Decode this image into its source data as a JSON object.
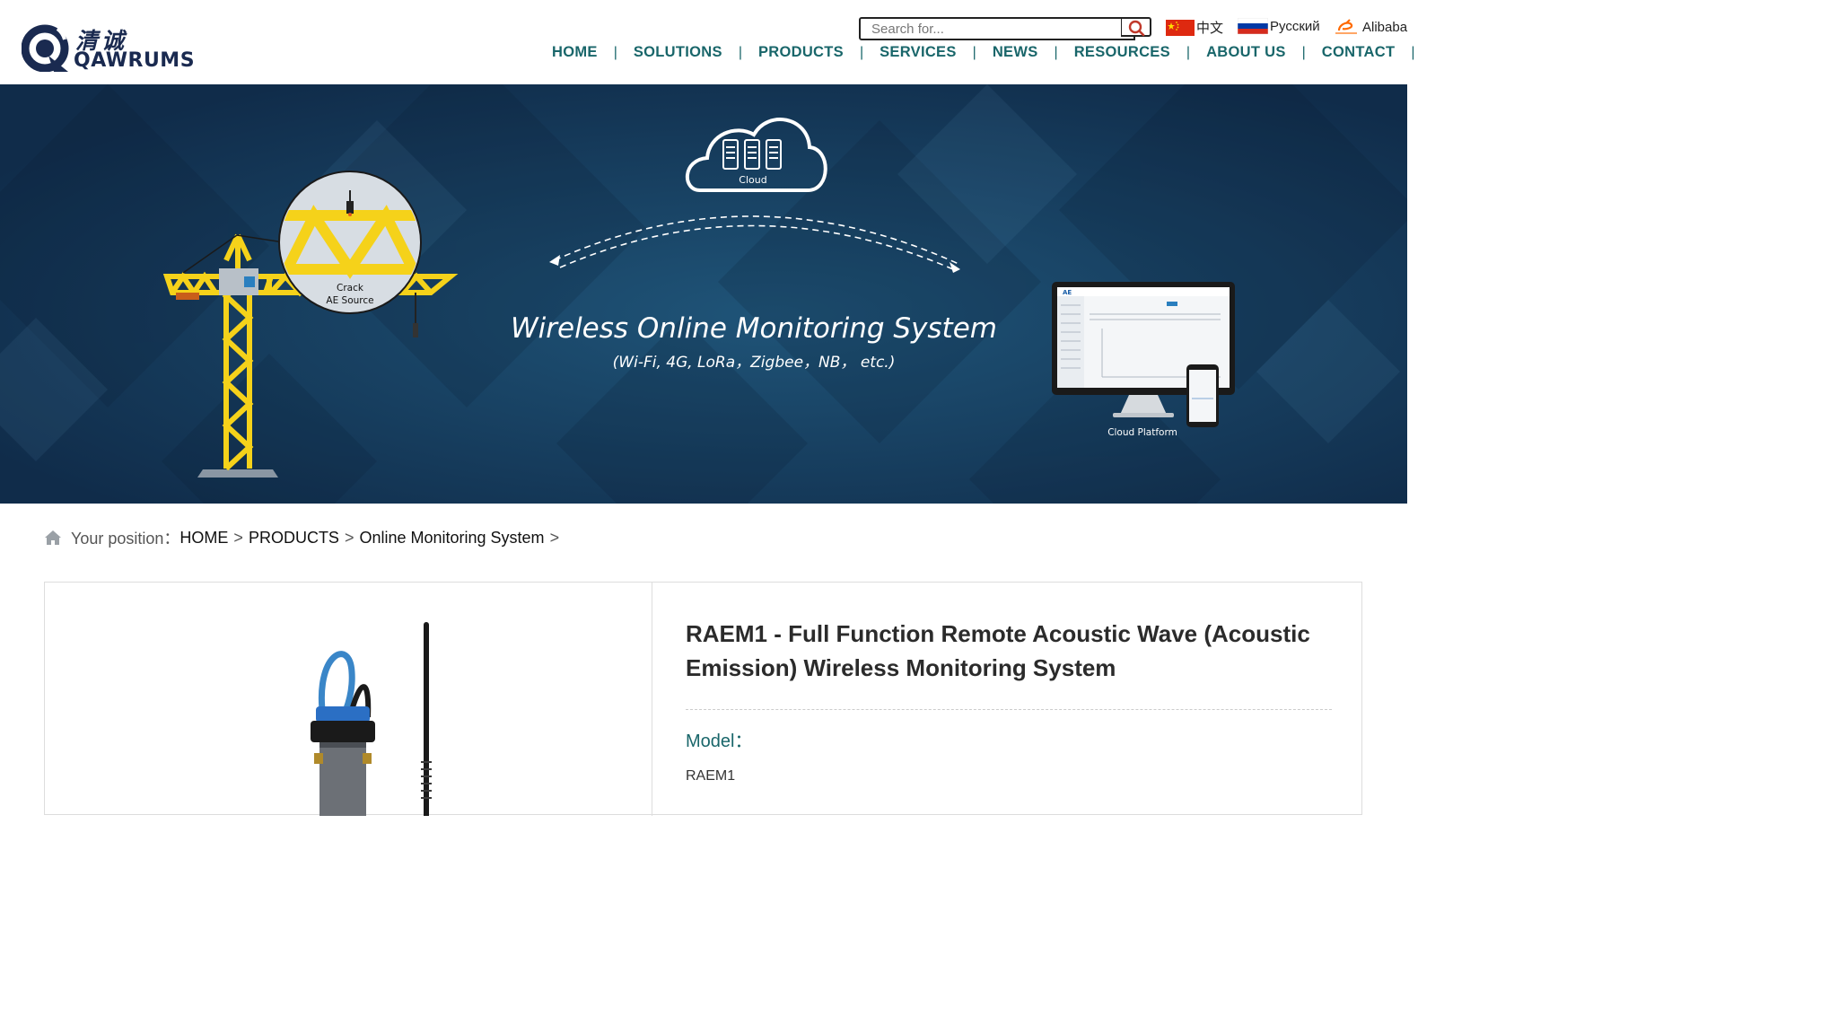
{
  "brand": {
    "cn_name": "清诚",
    "en_name": "QAWRUMS",
    "brand_color": "#1a2a50"
  },
  "search": {
    "placeholder": "Search for..."
  },
  "languages": [
    {
      "label": "中文",
      "icon": "china-flag-icon"
    },
    {
      "label": "Русский",
      "icon": "russia-flag-icon"
    },
    {
      "label": "Alibaba",
      "icon": "alibaba-icon"
    }
  ],
  "nav": [
    "HOME",
    "SOLUTIONS",
    "PRODUCTS",
    "SERVICES",
    "NEWS",
    "RESOURCES",
    "ABOUT US",
    "CONTACT"
  ],
  "nav_separator": "|",
  "nav_color": "#19666a",
  "banner": {
    "headline": "Wireless Online Monitoring System",
    "subtitle": "(Wi-Fi, 4G, LoRa，Zigbee，NB， etc.)",
    "cloud_label": "Cloud",
    "crack_label": "Crack",
    "source_label": "AE Source",
    "platform_label": "Cloud Platform",
    "background": "#163a5c"
  },
  "breadcrumb": {
    "prefix": "Your position：",
    "items": [
      "HOME",
      "PRODUCTS",
      "Online Monitoring System"
    ],
    "separator": ">"
  },
  "product": {
    "title": "RAEM1 - Full Function Remote Acoustic Wave (Acoustic Emission) Wireless Monitoring System",
    "model_label": "Model：",
    "model_value": "RAEM1"
  }
}
